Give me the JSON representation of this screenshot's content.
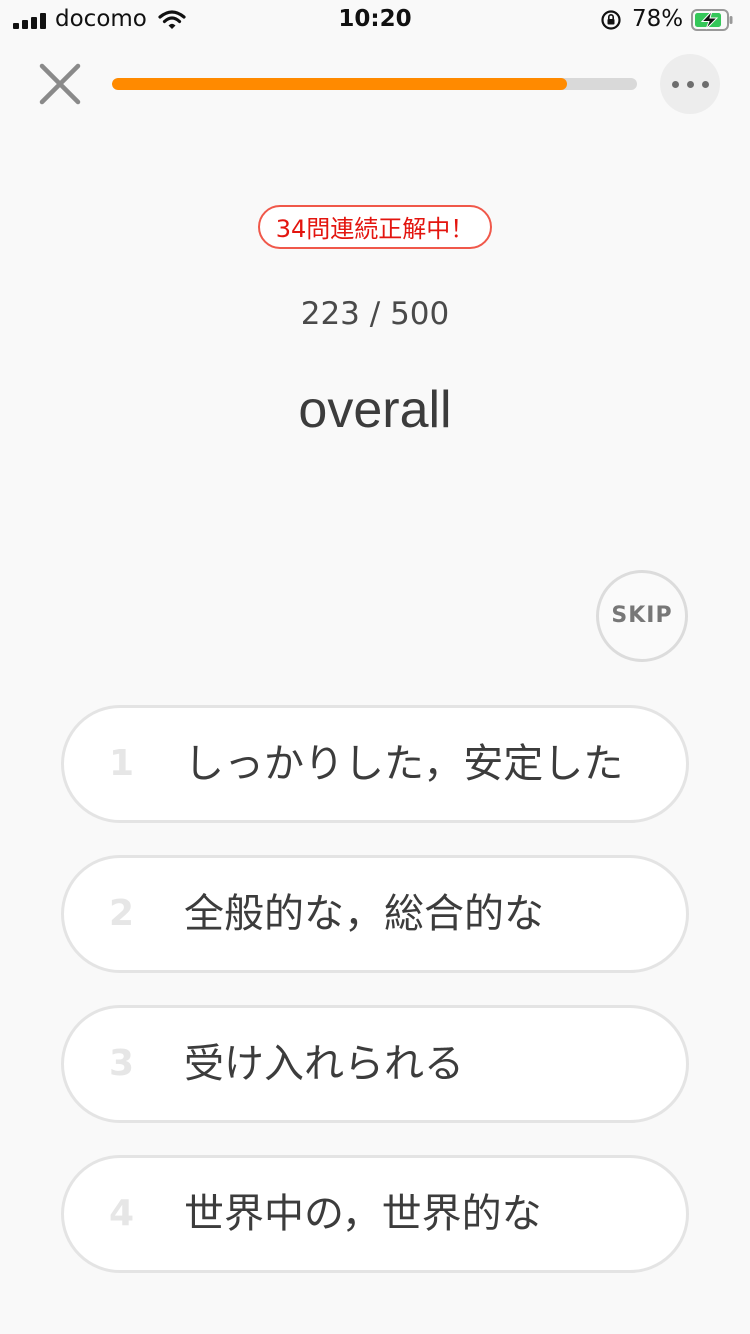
{
  "status_bar": {
    "carrier": "docomo",
    "time": "10:20",
    "battery": "78%"
  },
  "nav": {
    "close_icon": "close-icon",
    "menu_icon": "more-horizontal-icon",
    "progress_fraction": 0.866
  },
  "quiz": {
    "streak_badge": "34問連続正解中！",
    "current": "223",
    "separator": "/",
    "total": "500",
    "word": "overall",
    "skip_label": "SKIP",
    "choices": [
      {
        "number": "1",
        "label": "しっかりした，安定した"
      },
      {
        "number": "2",
        "label": "全般的な，総合的な"
      },
      {
        "number": "3",
        "label": "受け入れられる"
      },
      {
        "number": "4",
        "label": "世界中の，世界的な"
      }
    ]
  },
  "colors": {
    "accent": "#ff8a00",
    "streak": "#e3150f",
    "background": "#f9f9f9"
  }
}
